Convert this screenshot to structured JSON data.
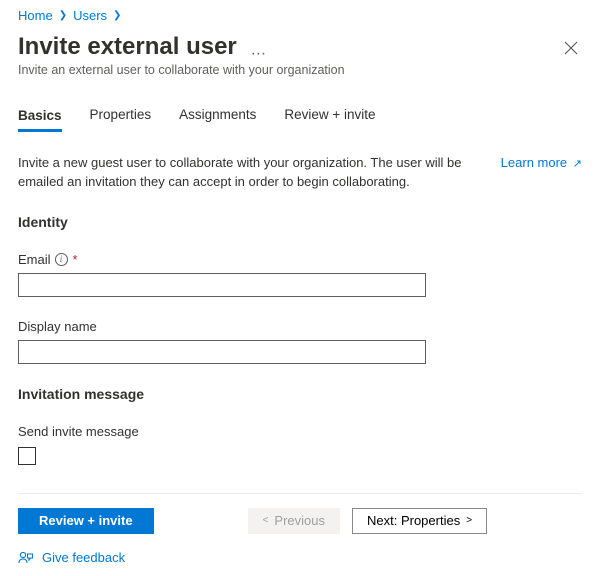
{
  "breadcrumb": {
    "items": [
      "Home",
      "Users"
    ]
  },
  "header": {
    "title": "Invite external user",
    "more": "…",
    "subtitle": "Invite an external user to collaborate with your organization"
  },
  "tabs": {
    "items": [
      "Basics",
      "Properties",
      "Assignments",
      "Review + invite"
    ],
    "active_index": 0
  },
  "intro": {
    "text": "Invite a new guest user to collaborate with your organization. The user will be emailed an invitation they can accept in order to begin collaborating.",
    "learn_more": "Learn more"
  },
  "sections": {
    "identity_heading": "Identity",
    "email_label": "Email",
    "email_required": "*",
    "email_value": "",
    "display_name_label": "Display name",
    "display_name_value": "",
    "invitation_heading": "Invitation message",
    "send_invite_label": "Send invite message",
    "send_invite_checked": false
  },
  "footer": {
    "primary": "Review + invite",
    "previous": "Previous",
    "next": "Next: Properties",
    "feedback": "Give feedback"
  }
}
